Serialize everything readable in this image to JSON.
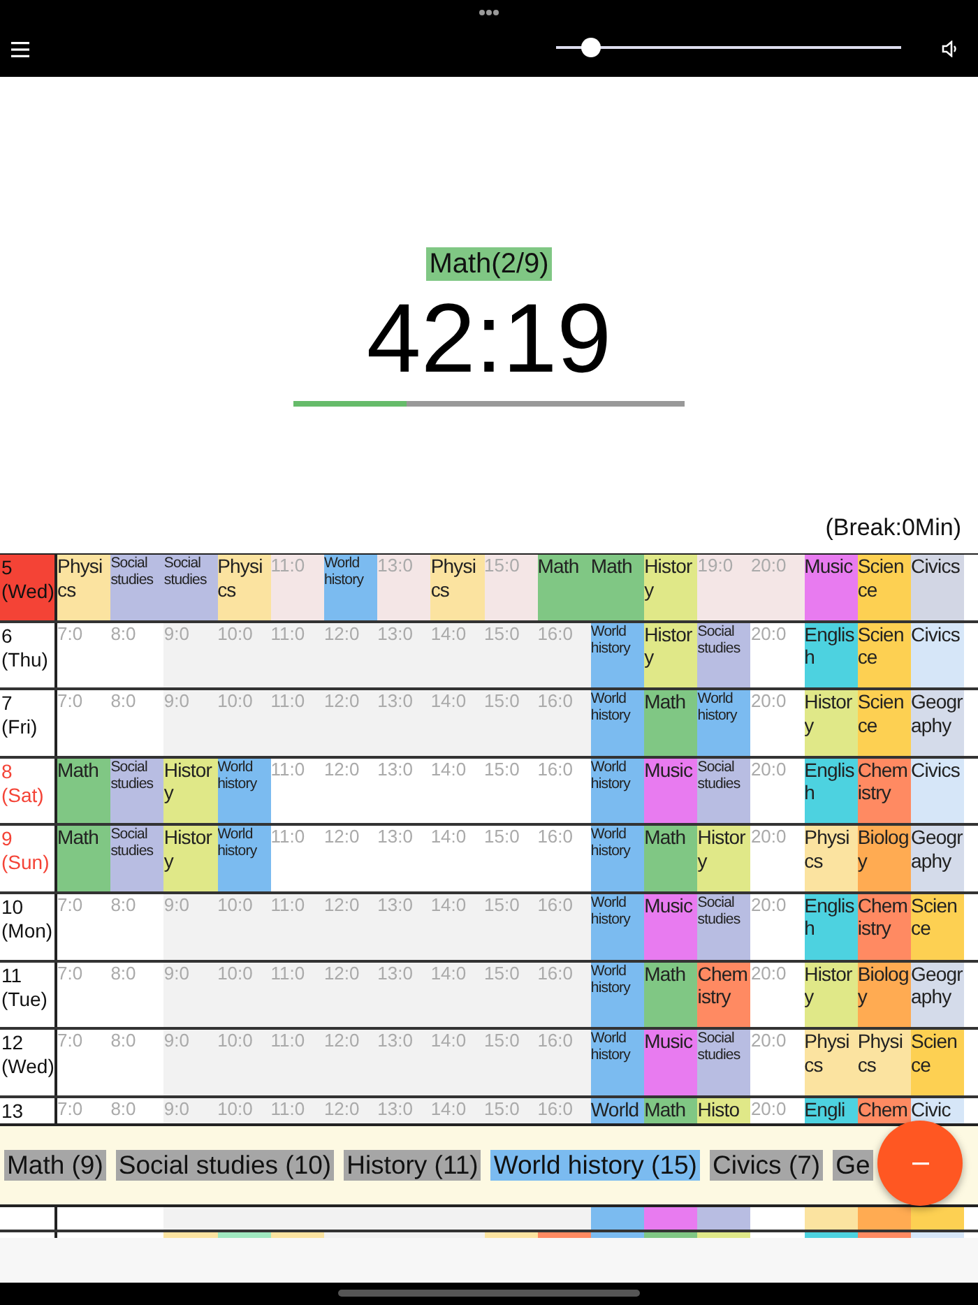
{
  "top_bar": {
    "volume": {
      "level": 0.1
    }
  },
  "session": {
    "subject": "Math(2/9)",
    "timer": "42:19",
    "progress": {
      "level": 0.29
    },
    "break_note": "(Break:0Min)"
  },
  "timetable": {
    "rows": [
      {
        "day": "5",
        "weekday": "(Wed)",
        "selected": true,
        "holiday": false,
        "cells": [
          {
            "kind": "subject",
            "label": "Physics",
            "color": "#fbe3a0"
          },
          {
            "kind": "subject",
            "label": "Social studies",
            "color": "#b8bde2"
          },
          {
            "kind": "subject",
            "label": "Social studies",
            "color": "#b8bde2"
          },
          {
            "kind": "subject",
            "label": "Physics",
            "color": "#fbe3a0"
          },
          {
            "kind": "empty",
            "label": "11:0"
          },
          {
            "kind": "subject",
            "label": "World history",
            "color": "#7bbbf0"
          },
          {
            "kind": "empty",
            "label": "13:0"
          },
          {
            "kind": "subject",
            "label": "Physics",
            "color": "#fbe3a0"
          },
          {
            "kind": "empty",
            "label": "15:0"
          },
          {
            "kind": "subject",
            "label": "Math",
            "color": "#80c784"
          },
          {
            "kind": "subject",
            "label": "Math",
            "color": "#80c784"
          },
          {
            "kind": "subject",
            "label": "History",
            "color": "#e0e888"
          },
          {
            "kind": "empty",
            "label": "19:0"
          },
          {
            "kind": "empty",
            "label": "20:0"
          },
          {
            "kind": "subject",
            "label": "Music",
            "color": "#e87bf0"
          },
          {
            "kind": "subject",
            "label": "Science",
            "color": "#fdd052"
          },
          {
            "kind": "subject",
            "label": "Civics",
            "color": "#d2d6e4"
          }
        ]
      },
      {
        "day": "6",
        "weekday": "(Thu)",
        "selected": false,
        "holiday": false,
        "cells": [
          {
            "kind": "empty",
            "label": "7:0"
          },
          {
            "kind": "empty",
            "label": "8:0"
          },
          {
            "kind": "empty",
            "label": "9:0"
          },
          {
            "kind": "empty",
            "label": "10:0"
          },
          {
            "kind": "empty",
            "label": "11:0"
          },
          {
            "kind": "empty",
            "label": "12:0"
          },
          {
            "kind": "empty",
            "label": "13:0"
          },
          {
            "kind": "empty",
            "label": "14:0"
          },
          {
            "kind": "empty",
            "label": "15:0"
          },
          {
            "kind": "empty",
            "label": "16:0"
          },
          {
            "kind": "subject",
            "label": "World history",
            "color": "#7bbbf0"
          },
          {
            "kind": "subject",
            "label": "History",
            "color": "#e0e888"
          },
          {
            "kind": "subject",
            "label": "Social studies",
            "color": "#b8bde2"
          },
          {
            "kind": "empty",
            "label": "20:0"
          },
          {
            "kind": "subject",
            "label": "English",
            "color": "#4dd2e0"
          },
          {
            "kind": "subject",
            "label": "Science",
            "color": "#fdd052"
          },
          {
            "kind": "subject",
            "label": "Civics",
            "color": "#d6e6f8"
          }
        ]
      },
      {
        "day": "7",
        "weekday": "(Fri)",
        "selected": false,
        "holiday": false,
        "cells": [
          {
            "kind": "empty",
            "label": "7:0"
          },
          {
            "kind": "empty",
            "label": "8:0"
          },
          {
            "kind": "empty",
            "label": "9:0"
          },
          {
            "kind": "empty",
            "label": "10:0"
          },
          {
            "kind": "empty",
            "label": "11:0"
          },
          {
            "kind": "empty",
            "label": "12:0"
          },
          {
            "kind": "empty",
            "label": "13:0"
          },
          {
            "kind": "empty",
            "label": "14:0"
          },
          {
            "kind": "empty",
            "label": "15:0"
          },
          {
            "kind": "empty",
            "label": "16:0"
          },
          {
            "kind": "subject",
            "label": "World history",
            "color": "#7bbbf0"
          },
          {
            "kind": "subject",
            "label": "Math",
            "color": "#80c784"
          },
          {
            "kind": "subject",
            "label": "World history",
            "color": "#7bbbf0"
          },
          {
            "kind": "empty",
            "label": "20:0"
          },
          {
            "kind": "subject",
            "label": "History",
            "color": "#e0e888"
          },
          {
            "kind": "subject",
            "label": "Science",
            "color": "#fdd052"
          },
          {
            "kind": "subject",
            "label": "Geography",
            "color": "#d4dbea"
          }
        ]
      },
      {
        "day": "8",
        "weekday": "(Sat)",
        "selected": false,
        "holiday": true,
        "cells": [
          {
            "kind": "subject",
            "label": "Math",
            "color": "#80c784"
          },
          {
            "kind": "subject",
            "label": "Social studies",
            "color": "#b8bde2"
          },
          {
            "kind": "subject",
            "label": "History",
            "color": "#e0e888"
          },
          {
            "kind": "subject",
            "label": "World history",
            "color": "#7bbbf0"
          },
          {
            "kind": "empty",
            "label": "11:0"
          },
          {
            "kind": "empty",
            "label": "12:0"
          },
          {
            "kind": "empty",
            "label": "13:0"
          },
          {
            "kind": "empty",
            "label": "14:0"
          },
          {
            "kind": "empty",
            "label": "15:0"
          },
          {
            "kind": "empty",
            "label": "16:0"
          },
          {
            "kind": "subject",
            "label": "World history",
            "color": "#7bbbf0"
          },
          {
            "kind": "subject",
            "label": "Music",
            "color": "#e87bf0"
          },
          {
            "kind": "subject",
            "label": "Social studies",
            "color": "#b8bde2"
          },
          {
            "kind": "empty",
            "label": "20:0"
          },
          {
            "kind": "subject",
            "label": "English",
            "color": "#4dd2e0"
          },
          {
            "kind": "subject",
            "label": "Chemistry",
            "color": "#ff8a62"
          },
          {
            "kind": "subject",
            "label": "Civics",
            "color": "#d6e6f8"
          }
        ]
      },
      {
        "day": "9",
        "weekday": "(Sun)",
        "selected": false,
        "holiday": true,
        "cells": [
          {
            "kind": "subject",
            "label": "Math",
            "color": "#80c784"
          },
          {
            "kind": "subject",
            "label": "Social studies",
            "color": "#b8bde2"
          },
          {
            "kind": "subject",
            "label": "History",
            "color": "#e0e888"
          },
          {
            "kind": "subject",
            "label": "World history",
            "color": "#7bbbf0"
          },
          {
            "kind": "empty",
            "label": "11:0"
          },
          {
            "kind": "empty",
            "label": "12:0"
          },
          {
            "kind": "empty",
            "label": "13:0"
          },
          {
            "kind": "empty",
            "label": "14:0"
          },
          {
            "kind": "empty",
            "label": "15:0"
          },
          {
            "kind": "empty",
            "label": "16:0"
          },
          {
            "kind": "subject",
            "label": "World history",
            "color": "#7bbbf0"
          },
          {
            "kind": "subject",
            "label": "Math",
            "color": "#80c784"
          },
          {
            "kind": "subject",
            "label": "History",
            "color": "#e0e888"
          },
          {
            "kind": "empty",
            "label": "20:0"
          },
          {
            "kind": "subject",
            "label": "Physics",
            "color": "#fbe3a0"
          },
          {
            "kind": "subject",
            "label": "Biology",
            "color": "#ffab52"
          },
          {
            "kind": "subject",
            "label": "Geography",
            "color": "#d4dbea"
          }
        ]
      },
      {
        "day": "10",
        "weekday": "(Mon)",
        "selected": false,
        "holiday": false,
        "cells": [
          {
            "kind": "empty",
            "label": "7:0"
          },
          {
            "kind": "empty",
            "label": "8:0"
          },
          {
            "kind": "empty",
            "label": "9:0"
          },
          {
            "kind": "empty",
            "label": "10:0"
          },
          {
            "kind": "empty",
            "label": "11:0"
          },
          {
            "kind": "empty",
            "label": "12:0"
          },
          {
            "kind": "empty",
            "label": "13:0"
          },
          {
            "kind": "empty",
            "label": "14:0"
          },
          {
            "kind": "empty",
            "label": "15:0"
          },
          {
            "kind": "empty",
            "label": "16:0"
          },
          {
            "kind": "subject",
            "label": "World history",
            "color": "#7bbbf0"
          },
          {
            "kind": "subject",
            "label": "Music",
            "color": "#e87bf0"
          },
          {
            "kind": "subject",
            "label": "Social studies",
            "color": "#b8bde2"
          },
          {
            "kind": "empty",
            "label": "20:0"
          },
          {
            "kind": "subject",
            "label": "English",
            "color": "#4dd2e0"
          },
          {
            "kind": "subject",
            "label": "Chemistry",
            "color": "#ff8a62"
          },
          {
            "kind": "subject",
            "label": "Science",
            "color": "#fdd052"
          }
        ]
      },
      {
        "day": "11",
        "weekday": "(Tue)",
        "selected": false,
        "holiday": false,
        "cells": [
          {
            "kind": "empty",
            "label": "7:0"
          },
          {
            "kind": "empty",
            "label": "8:0"
          },
          {
            "kind": "empty",
            "label": "9:0"
          },
          {
            "kind": "empty",
            "label": "10:0"
          },
          {
            "kind": "empty",
            "label": "11:0"
          },
          {
            "kind": "empty",
            "label": "12:0"
          },
          {
            "kind": "empty",
            "label": "13:0"
          },
          {
            "kind": "empty",
            "label": "14:0"
          },
          {
            "kind": "empty",
            "label": "15:0"
          },
          {
            "kind": "empty",
            "label": "16:0"
          },
          {
            "kind": "subject",
            "label": "World history",
            "color": "#7bbbf0"
          },
          {
            "kind": "subject",
            "label": "Math",
            "color": "#80c784"
          },
          {
            "kind": "subject",
            "label": "Chemistry",
            "color": "#ff8a62"
          },
          {
            "kind": "empty",
            "label": "20:0"
          },
          {
            "kind": "subject",
            "label": "History",
            "color": "#e0e888"
          },
          {
            "kind": "subject",
            "label": "Biology",
            "color": "#ffab52"
          },
          {
            "kind": "subject",
            "label": "Geography",
            "color": "#d4dbea"
          }
        ]
      },
      {
        "day": "12",
        "weekday": "(Wed)",
        "selected": false,
        "holiday": false,
        "cells": [
          {
            "kind": "empty",
            "label": "7:0"
          },
          {
            "kind": "empty",
            "label": "8:0"
          },
          {
            "kind": "empty",
            "label": "9:0"
          },
          {
            "kind": "empty",
            "label": "10:0"
          },
          {
            "kind": "empty",
            "label": "11:0"
          },
          {
            "kind": "empty",
            "label": "12:0"
          },
          {
            "kind": "empty",
            "label": "13:0"
          },
          {
            "kind": "empty",
            "label": "14:0"
          },
          {
            "kind": "empty",
            "label": "15:0"
          },
          {
            "kind": "empty",
            "label": "16:0"
          },
          {
            "kind": "subject",
            "label": "World history",
            "color": "#7bbbf0"
          },
          {
            "kind": "subject",
            "label": "Music",
            "color": "#e87bf0"
          },
          {
            "kind": "subject",
            "label": "Social studies",
            "color": "#b8bde2"
          },
          {
            "kind": "empty",
            "label": "20:0"
          },
          {
            "kind": "subject",
            "label": "Physics",
            "color": "#fbe3a0"
          },
          {
            "kind": "subject",
            "label": "Physics",
            "color": "#fbe3a0"
          },
          {
            "kind": "subject",
            "label": "Science",
            "color": "#fdd052"
          }
        ]
      },
      {
        "day": "13",
        "selected": false,
        "holiday": false,
        "cells": [
          {
            "kind": "empty",
            "label": "7:0"
          },
          {
            "kind": "empty",
            "label": "8:0"
          },
          {
            "kind": "empty",
            "label": "9:0"
          },
          {
            "kind": "empty",
            "label": "10:0"
          },
          {
            "kind": "empty",
            "label": "11:0"
          },
          {
            "kind": "empty",
            "label": "12:0"
          },
          {
            "kind": "empty",
            "label": "13:0"
          },
          {
            "kind": "empty",
            "label": "14:0"
          },
          {
            "kind": "empty",
            "label": "15:0"
          },
          {
            "kind": "empty",
            "label": "16:0"
          },
          {
            "kind": "subject",
            "label": "World",
            "color": "#7bbbf0"
          },
          {
            "kind": "subject",
            "label": "Math",
            "color": "#80c784"
          },
          {
            "kind": "subject",
            "label": "Histo",
            "color": "#e0e888"
          },
          {
            "kind": "empty",
            "label": "20:0"
          },
          {
            "kind": "subject",
            "label": "Engli",
            "color": "#4dd2e0"
          },
          {
            "kind": "subject",
            "label": "Chem",
            "color": "#ff8a62"
          },
          {
            "kind": "subject",
            "label": "Civic",
            "color": "#d6e6f8"
          }
        ]
      }
    ]
  },
  "subject_bar": [
    {
      "label": "Math (9)",
      "selected": false
    },
    {
      "label": "Social studies (10)",
      "selected": false
    },
    {
      "label": "History (11)",
      "selected": false
    },
    {
      "label": "World history (15)",
      "selected": true
    },
    {
      "label": "Civics (7)",
      "selected": false
    },
    {
      "label": "Ge",
      "selected": false
    }
  ],
  "timetable_below": {
    "rows": [
      {
        "cells": [
          {
            "kind": "empty"
          },
          {
            "kind": "empty"
          },
          {
            "kind": "empty"
          },
          {
            "kind": "empty"
          },
          {
            "kind": "empty"
          },
          {
            "kind": "empty"
          },
          {
            "kind": "empty"
          },
          {
            "kind": "empty"
          },
          {
            "kind": "empty"
          },
          {
            "kind": "empty"
          },
          {
            "kind": "subject",
            "color": "#7bbbf0"
          },
          {
            "kind": "subject",
            "color": "#e87bf0"
          },
          {
            "kind": "subject",
            "color": "#b8bde2"
          },
          {
            "kind": "empty"
          },
          {
            "kind": "subject",
            "color": "#fbe3a0"
          },
          {
            "kind": "subject",
            "color": "#ffab52"
          },
          {
            "kind": "subject",
            "color": "#fdd052"
          }
        ]
      },
      {
        "cells": [
          {
            "kind": "empty"
          },
          {
            "kind": "empty"
          },
          {
            "kind": "subject",
            "color": "#fbe3a0"
          },
          {
            "kind": "subject",
            "color": "#a0e8c0"
          },
          {
            "kind": "subject",
            "color": "#fbe3a0"
          },
          {
            "kind": "empty"
          },
          {
            "kind": "empty"
          },
          {
            "kind": "empty"
          },
          {
            "kind": "subject",
            "color": "#fbe3a0"
          },
          {
            "kind": "subject",
            "color": "#ff8a62"
          },
          {
            "kind": "subject",
            "color": "#7bbbf0"
          },
          {
            "kind": "subject",
            "color": "#80c784"
          },
          {
            "kind": "subject",
            "color": "#e0e888"
          },
          {
            "kind": "empty"
          },
          {
            "kind": "subject",
            "color": "#4dd2e0"
          },
          {
            "kind": "subject",
            "color": "#ff8a62"
          },
          {
            "kind": "subject",
            "color": "#d6e6f8"
          }
        ]
      }
    ]
  }
}
